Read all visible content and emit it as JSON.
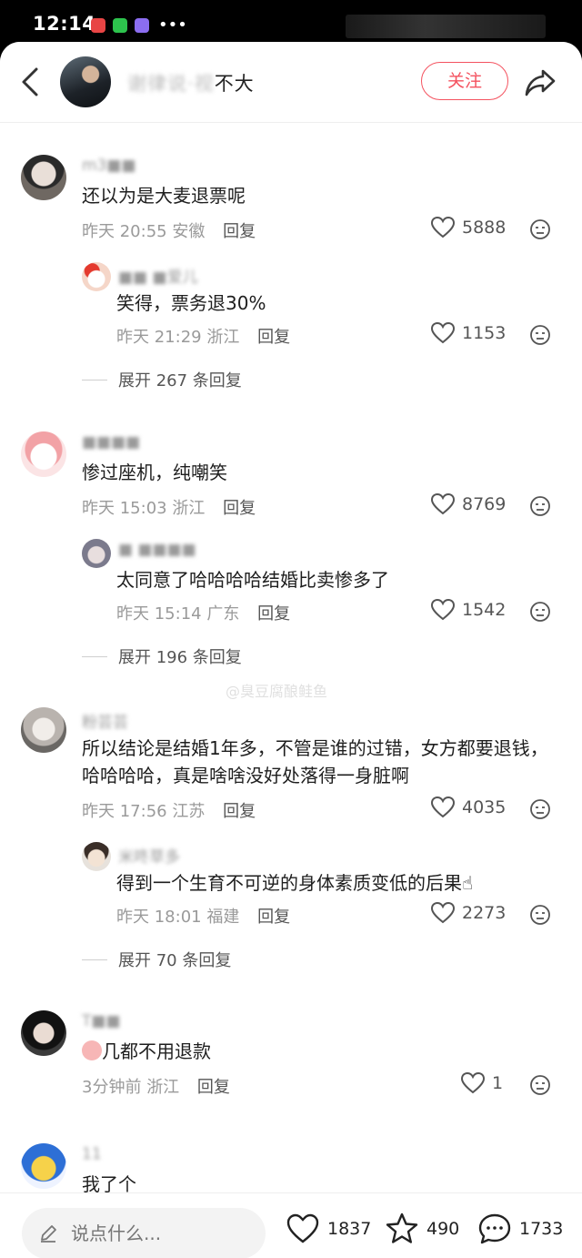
{
  "status_bar": {
    "time": "12:14",
    "more": "•••"
  },
  "header": {
    "author_name_visible": "不大",
    "author_name_obscured": "谢律说·视",
    "follow_label": "关注"
  },
  "comments": [
    {
      "user": "m3■■",
      "text": "还以为是大麦退票呢",
      "time": "昨天 20:55",
      "location": "安徽",
      "reply_label": "回复",
      "likes": "5888",
      "reply": {
        "user": "■■ ■爱儿",
        "text": "笑得，票务退30%",
        "time": "昨天 21:29",
        "location": "浙江",
        "reply_label": "回复",
        "likes": "1153"
      },
      "expand": "展开 267 条回复"
    },
    {
      "user": "■■■■",
      "text": "惨过座机，纯嘲笑",
      "time": "昨天 15:03",
      "location": "浙江",
      "reply_label": "回复",
      "likes": "8769",
      "reply": {
        "user": "■ ■■■■",
        "text": "太同意了哈哈哈哈结婚比卖惨多了",
        "time": "昨天 15:14",
        "location": "广东",
        "reply_label": "回复",
        "likes": "1542"
      },
      "expand": "展开 196 条回复"
    },
    {
      "user": "粉芸芸",
      "text": "所以结论是结婚1年多，不管是谁的过错，女方都要退钱，哈哈哈哈，真是啥啥没好处落得一身脏啊",
      "time": "昨天 17:56",
      "location": "江苏",
      "reply_label": "回复",
      "likes": "4035",
      "reply": {
        "user": "米咚草多",
        "text": "得到一个生育不可逆的身体素质变低的后果☝",
        "time": "昨天 18:01",
        "location": "福建",
        "reply_label": "回复",
        "likes": "2273"
      },
      "expand": "展开 70 条回复"
    },
    {
      "user": "T■■",
      "text": "几都不用退款",
      "time": "3分钟前",
      "location": "浙江",
      "reply_label": "回复",
      "likes": "1"
    },
    {
      "user": "11",
      "text": "我了个"
    }
  ],
  "watermark": "@臭豆腐酿鲑鱼",
  "bottom_bar": {
    "input_placeholder": "说点什么...",
    "likes": "1837",
    "favorites": "490",
    "comments": "1733"
  },
  "colors": {
    "accent": "#f4525f",
    "muted": "#9a9a9a"
  }
}
